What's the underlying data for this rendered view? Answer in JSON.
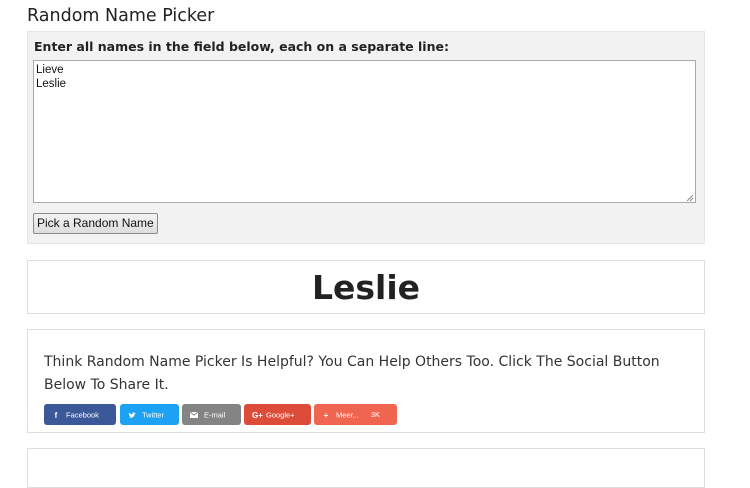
{
  "page": {
    "title": "Random Name Picker"
  },
  "picker": {
    "instruction": "Enter all names in the field below, each on a separate line:",
    "names_value": "Lieve\nLeslie",
    "button_label": "Pick a Random Name"
  },
  "result": {
    "name": "Leslie"
  },
  "share": {
    "text": "Think Random Name Picker Is Helpful? You Can Help Others Too. Click The Social Button Below To Share It.",
    "buttons": [
      {
        "label": "Facebook",
        "icon": "facebook-icon",
        "color": "#3b5998"
      },
      {
        "label": "Twitter",
        "icon": "twitter-icon",
        "color": "#1da1f2"
      },
      {
        "label": "E-mail",
        "icon": "email-icon",
        "color": "#848484"
      },
      {
        "label": "Google+",
        "icon": "google-plus-icon",
        "color": "#dd4b39"
      },
      {
        "label": "Meer...",
        "icon": "plus-icon",
        "color": "#f0654f",
        "count": "3K"
      }
    ]
  }
}
